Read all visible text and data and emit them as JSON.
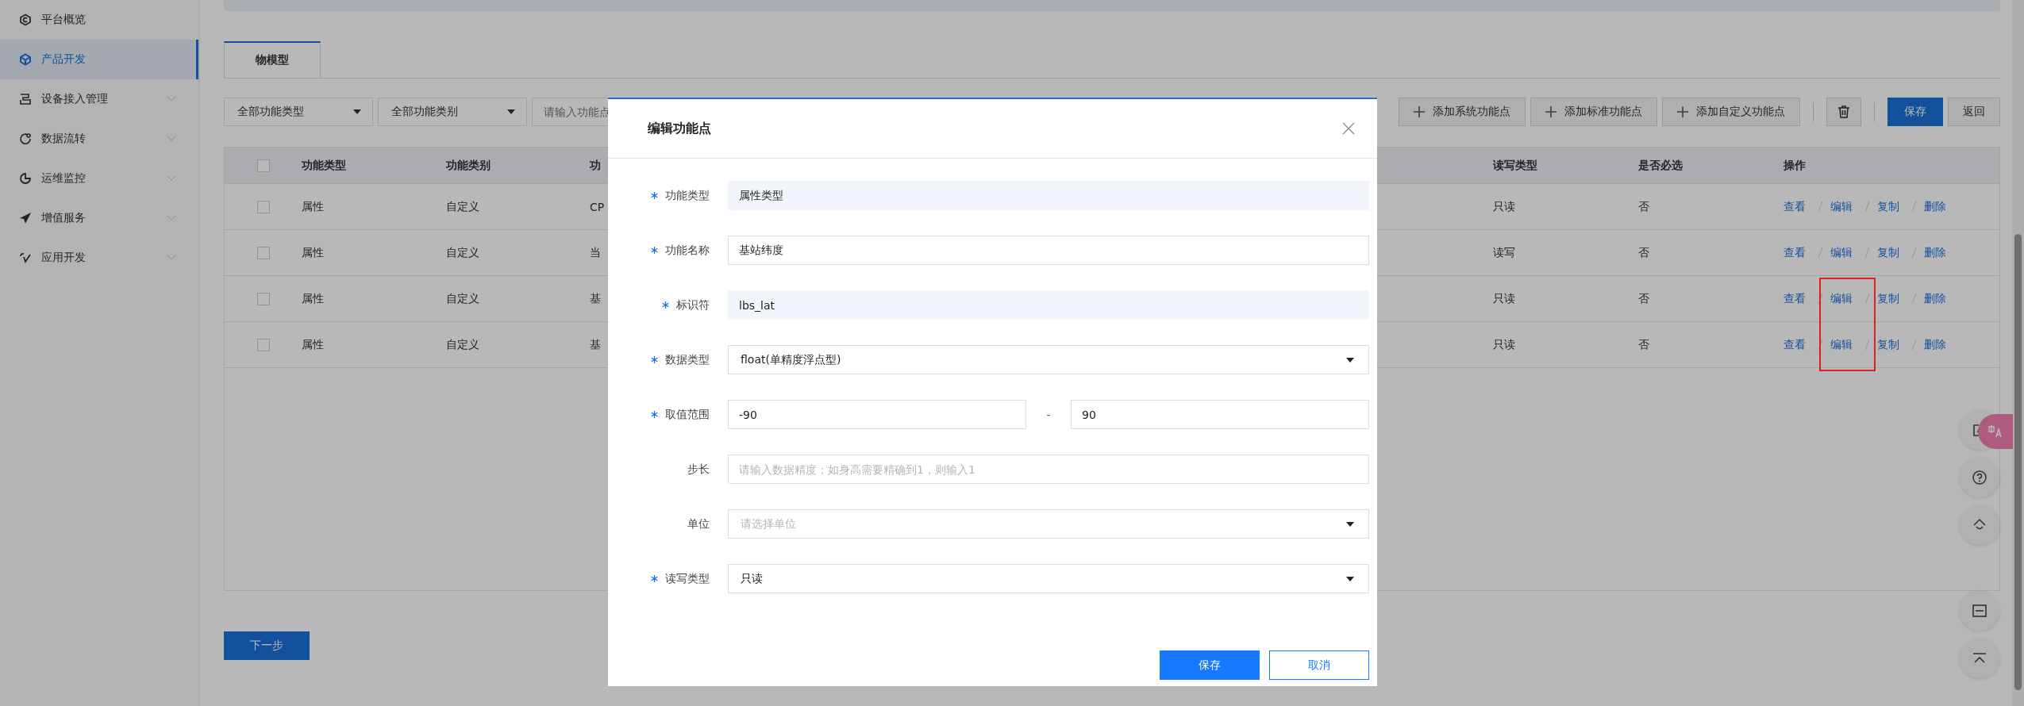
{
  "sidebar": {
    "items": [
      {
        "label": "平台概览",
        "selected": false,
        "has_submenu": false
      },
      {
        "label": "产品开发",
        "selected": true,
        "has_submenu": false
      },
      {
        "label": "设备接入管理",
        "selected": false,
        "has_submenu": true
      },
      {
        "label": "数据流转",
        "selected": false,
        "has_submenu": true
      },
      {
        "label": "运维监控",
        "selected": false,
        "has_submenu": true
      },
      {
        "label": "增值服务",
        "selected": false,
        "has_submenu": true
      },
      {
        "label": "应用开发",
        "selected": false,
        "has_submenu": true
      }
    ]
  },
  "tabs": [
    {
      "label": "物模型",
      "selected": true
    }
  ],
  "filters": {
    "type_select": "全部功能类型",
    "category_select": "全部功能类别",
    "search_placeholder": "请输入功能点"
  },
  "toolbar": {
    "buttons": [
      {
        "label": "添加系统功能点",
        "kind": "add"
      },
      {
        "label": "添加标准功能点",
        "kind": "add"
      },
      {
        "label": "添加自定义功能点",
        "kind": "add"
      },
      {
        "kind": "delete"
      },
      {
        "label": "保存",
        "kind": "primary"
      },
      {
        "label": "返回",
        "kind": "default"
      }
    ]
  },
  "table": {
    "header_checked": false,
    "columns": [
      "功能类型",
      "功能类别",
      "功",
      "读写类型",
      "是否必选",
      "操作"
    ],
    "rows": [
      {
        "checked": false,
        "cells": [
          "属性",
          "自定义",
          "CP",
          "只读",
          "否"
        ],
        "actions": [
          {
            "label": "查看",
            "highlighted": false
          },
          {
            "label": "编辑",
            "highlighted": false
          },
          {
            "label": "复制",
            "highlighted": false
          },
          {
            "label": "删除",
            "highlighted": false
          }
        ]
      },
      {
        "checked": false,
        "cells": [
          "属性",
          "自定义",
          "当",
          "读写",
          "否"
        ],
        "actions": [
          {
            "label": "查看",
            "highlighted": false
          },
          {
            "label": "编辑",
            "highlighted": false
          },
          {
            "label": "复制",
            "highlighted": false
          },
          {
            "label": "删除",
            "highlighted": false
          }
        ]
      },
      {
        "checked": false,
        "cells": [
          "属性",
          "自定义",
          "基",
          "只读",
          "否"
        ],
        "actions": [
          {
            "label": "查看",
            "highlighted": false
          },
          {
            "label": "编辑",
            "highlighted": true
          },
          {
            "label": "复制",
            "highlighted": false
          },
          {
            "label": "删除",
            "highlighted": false
          }
        ]
      },
      {
        "checked": false,
        "cells": [
          "属性",
          "自定义",
          "基",
          "只读",
          "否"
        ],
        "actions": [
          {
            "label": "查看",
            "highlighted": false
          },
          {
            "label": "编辑",
            "highlighted": true
          },
          {
            "label": "复制",
            "highlighted": false
          },
          {
            "label": "删除",
            "highlighted": false
          }
        ]
      }
    ]
  },
  "next_button": "下一步",
  "dialog": {
    "title": "编辑功能点",
    "fields": [
      {
        "label": "功能类型",
        "required": true,
        "kind": "readonly",
        "value": "属性类型"
      },
      {
        "label": "功能名称",
        "required": true,
        "kind": "text",
        "value": "基站纬度"
      },
      {
        "label": "标识符",
        "required": true,
        "kind": "readonly",
        "value": "lbs_lat"
      },
      {
        "label": "数据类型",
        "required": true,
        "kind": "select",
        "value": "float(单精度浮点型)"
      },
      {
        "label": "取值范围",
        "required": true,
        "kind": "range",
        "min": "-90",
        "separator": "-",
        "max": "90"
      },
      {
        "label": "步长",
        "required": false,
        "kind": "text",
        "placeholder": "请输入数据精度；如身高需要精确到1，则输入1"
      },
      {
        "label": "单位",
        "required": false,
        "kind": "select",
        "placeholder": "请选择单位"
      },
      {
        "label": "读写类型",
        "required": true,
        "kind": "select",
        "value": "只读"
      }
    ],
    "buttons": [
      {
        "label": "保存",
        "kind": "primary"
      },
      {
        "label": "取消",
        "kind": "default"
      }
    ]
  }
}
